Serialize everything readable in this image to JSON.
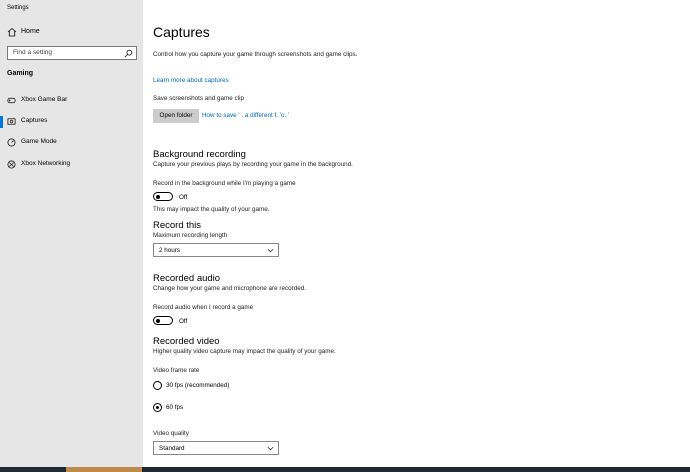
{
  "window": {
    "title": "Settings"
  },
  "sidebar": {
    "home_label": "Home",
    "search_placeholder": "Find a setting",
    "section": "Gaming",
    "items": [
      {
        "label": "Xbox Game Bar",
        "icon": "xbox-game-bar-icon"
      },
      {
        "label": "Captures",
        "icon": "captures-icon",
        "active": true
      },
      {
        "label": "Game Mode",
        "icon": "game-mode-icon"
      },
      {
        "label": "Xbox Networking",
        "icon": "xbox-icon"
      }
    ]
  },
  "main": {
    "title": "Captures",
    "description": "Control how you capture your game through screenshots and game clips.",
    "learn_more": "Learn more about captures",
    "save_location_label": "Save screenshots and game clip",
    "open_folder": "Open folder",
    "how_to_save": "How to save ' . a different f. 'o. '",
    "background_recording": {
      "heading": "Background recording",
      "description": "Capture your previous plays by recording your game in the background.",
      "toggle_label": "Record in the background while I'm playing a game",
      "toggle_state": "Off",
      "note": "This may impact the quality of your game."
    },
    "record_this": {
      "heading": "Record this",
      "label": "Maximum recording length",
      "value": "2 hours"
    },
    "recorded_audio": {
      "heading": "Recorded audio",
      "description": "Change how your game and microphone are recorded.",
      "toggle_label": "Record audio when I record a game",
      "toggle_state": "Off"
    },
    "recorded_video": {
      "heading": "Recorded video",
      "description": "Higher quality video capture may impact the quality of your game.",
      "frame_rate_label": "Video frame rate",
      "options": [
        {
          "label": "30 fps (recommended)",
          "checked": false
        },
        {
          "label": "60 fps",
          "checked": true
        }
      ],
      "quality_label": "Video quality",
      "quality_value": "Standard"
    }
  },
  "colors": {
    "accent": "#0078d7",
    "sidebar_bg": "#e6e6e6",
    "link": "#0067b8"
  }
}
